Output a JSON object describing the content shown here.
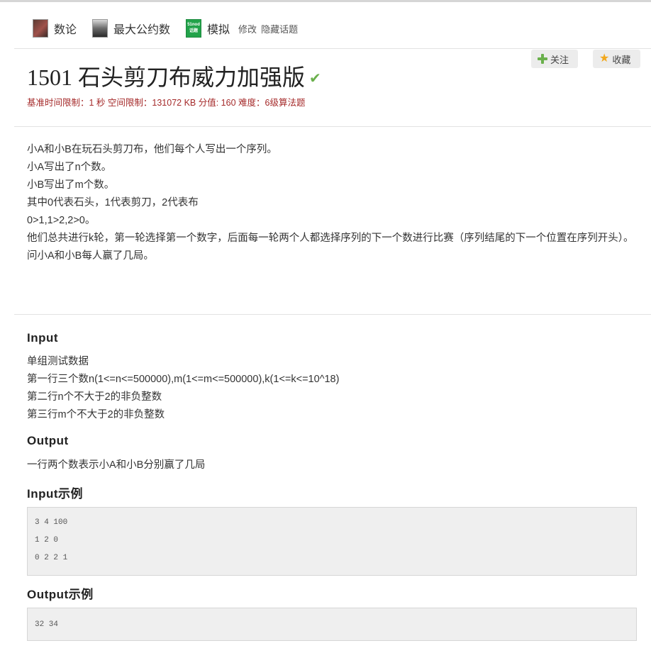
{
  "tags": [
    {
      "label": "数论",
      "icon": "number-theory-avatar-icon"
    },
    {
      "label": "最大公约数",
      "icon": "gcd-avatar-icon"
    },
    {
      "label": "模拟",
      "icon": "simulation-51nod-icon",
      "icon_text": "51nod 话题"
    }
  ],
  "tag_links": {
    "edit": "修改",
    "hide": "隐藏话题"
  },
  "actions": {
    "follow": "关注",
    "favorite": "收藏"
  },
  "problem": {
    "title": "1501 石头剪刀布威力加强版",
    "limits": "基准时间限制：1 秒 空间限制：131072 KB 分值: 160 难度：6级算法题",
    "description": [
      "小A和小B在玩石头剪刀布，他们每个人写出一个序列。",
      "小A写出了n个数。",
      "小B写出了m个数。",
      "其中0代表石头，1代表剪刀，2代表布",
      "0>1,1>2,2>0。",
      "他们总共进行k轮，第一轮选择第一个数字，后面每一轮两个人都选择序列的下一个数进行比赛（序列结尾的下一个位置在序列开头）。",
      "问小A和小B每人赢了几局。"
    ]
  },
  "input": {
    "heading": "Input",
    "lines": [
      "单组测试数据",
      "第一行三个数n(1<=n<=500000),m(1<=m<=500000),k(1<=k<=10^18)",
      "第二行n个不大于2的非负整数",
      "第三行m个不大于2的非负整数"
    ]
  },
  "output": {
    "heading": "Output",
    "text": "一行两个数表示小A和小B分别赢了几局"
  },
  "input_example": {
    "heading": "Input示例",
    "lines": [
      "3 4 100",
      "1 2 0",
      "0 2 2 1"
    ]
  },
  "output_example": {
    "heading": "Output示例",
    "text": "32 34"
  },
  "colors": {
    "limits": "#a52a2a",
    "accent_green": "#6ab04c",
    "star": "#f2a81d"
  }
}
